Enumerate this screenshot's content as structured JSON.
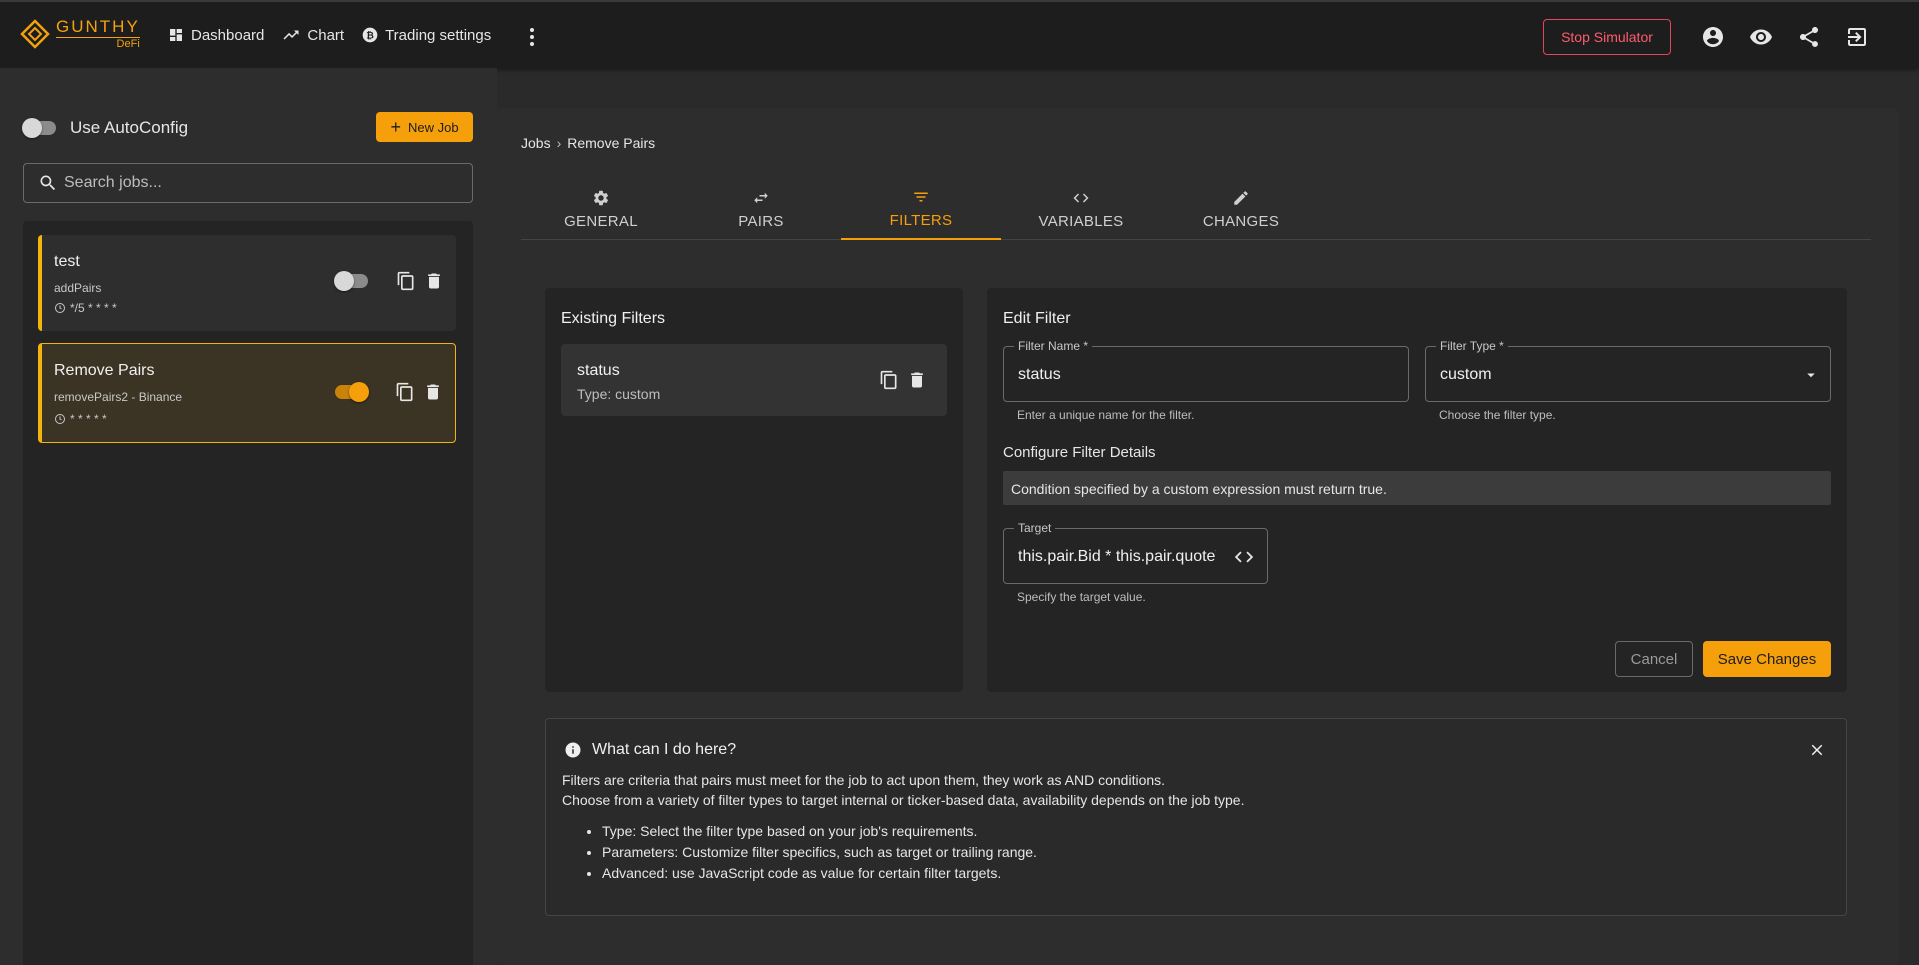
{
  "brand": {
    "name": "GUNTHY",
    "sub": "DeFi"
  },
  "nav": {
    "items": [
      {
        "label": "Dashboard",
        "icon": "dashboard-icon"
      },
      {
        "label": "Chart",
        "icon": "trending-up-icon"
      },
      {
        "label": "Trading settings",
        "icon": "bitcoin-icon"
      }
    ],
    "stop_simulator": "Stop Simulator"
  },
  "sidebar": {
    "autoconfig_label": "Use AutoConfig",
    "new_job_label": "New Job",
    "search_placeholder": "Search jobs...",
    "jobs": [
      {
        "name": "test",
        "type": "addPairs",
        "cron": "*/5 * * * *",
        "enabled": false,
        "selected": false
      },
      {
        "name": "Remove Pairs",
        "type": "removePairs2 - Binance",
        "cron": "* * * * *",
        "enabled": true,
        "selected": true
      }
    ]
  },
  "breadcrumb": {
    "root": "Jobs",
    "current": "Remove Pairs"
  },
  "tabs": [
    {
      "label": "GENERAL",
      "icon": "gear-icon"
    },
    {
      "label": "PAIRS",
      "icon": "swap-icon"
    },
    {
      "label": "FILTERS",
      "icon": "filter-icon",
      "active": true
    },
    {
      "label": "VARIABLES",
      "icon": "code-icon"
    },
    {
      "label": "CHANGES",
      "icon": "pencil-icon"
    }
  ],
  "existing_filters": {
    "title": "Existing Filters",
    "items": [
      {
        "name": "status",
        "type_text": "Type: custom"
      }
    ]
  },
  "edit_filter": {
    "title": "Edit Filter",
    "name_label": "Filter Name *",
    "name_value": "status",
    "name_helper": "Enter a unique name for the filter.",
    "type_label": "Filter Type *",
    "type_value": "custom",
    "type_helper": "Choose the filter type.",
    "configure_title": "Configure Filter Details",
    "description": "Condition specified by a custom expression must return true.",
    "target_label": "Target",
    "target_value": "this.pair.Bid * this.pair.quoteVolume",
    "target_helper": "Specify the target value.",
    "cancel_label": "Cancel",
    "save_label": "Save Changes"
  },
  "help": {
    "title": "What can I do here?",
    "line1": "Filters are criteria that pairs must meet for the job to act upon them, they work as AND conditions.",
    "line2": "Choose from a variety of filter types to target internal or ticker-based data, availability depends on the job type.",
    "bullets": [
      "Type: Select the filter type based on your job's requirements.",
      "Parameters: Customize filter specifics, such as target or trailing range.",
      "Advanced: use JavaScript code as value for certain filter targets."
    ]
  },
  "colors": {
    "accent": "#f59f0b",
    "danger": "#ff5c6f",
    "background": "#2a2a2a"
  }
}
